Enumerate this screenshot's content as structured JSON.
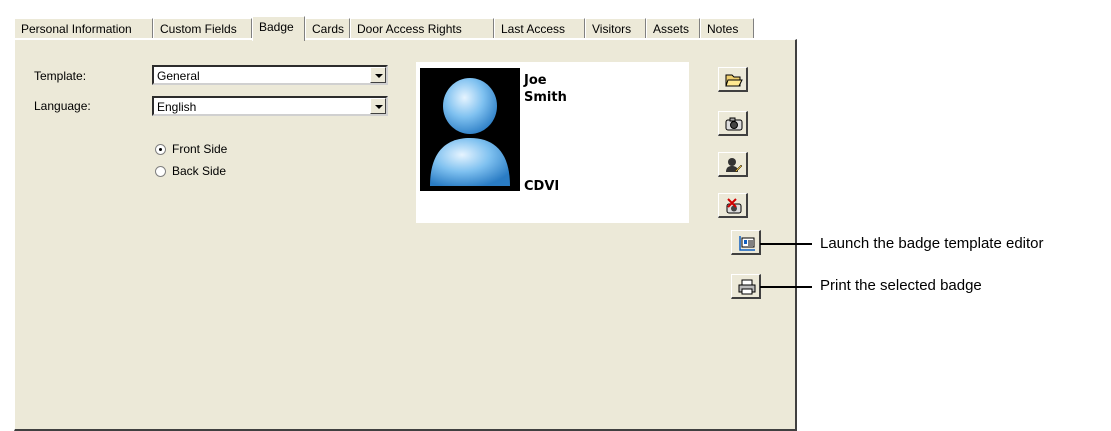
{
  "tabs": [
    {
      "label": "Personal Information"
    },
    {
      "label": "Custom Fields"
    },
    {
      "label": "Badge",
      "active": true
    },
    {
      "label": "Cards"
    },
    {
      "label": "Door Access Rights"
    },
    {
      "label": "Last Access"
    },
    {
      "label": "Visitors"
    },
    {
      "label": "Assets"
    },
    {
      "label": "Notes"
    }
  ],
  "form": {
    "template_label": "Template:",
    "template_value": "General",
    "language_label": "Language:",
    "language_value": "English",
    "front_side_label": "Front Side",
    "back_side_label": "Back Side",
    "selected_side": "Front Side"
  },
  "badge": {
    "first_name": "Joe",
    "last_name": "Smith",
    "company": "CDVI"
  },
  "toolbar": [
    {
      "name": "open-folder-icon"
    },
    {
      "name": "camera-icon"
    },
    {
      "name": "signature-icon"
    },
    {
      "name": "delete-photo-icon"
    },
    {
      "name": "badge-template-editor-icon"
    },
    {
      "name": "printer-icon"
    }
  ],
  "callouts": {
    "template_editor": "Launch the badge template editor",
    "print": "Print the selected badge"
  }
}
